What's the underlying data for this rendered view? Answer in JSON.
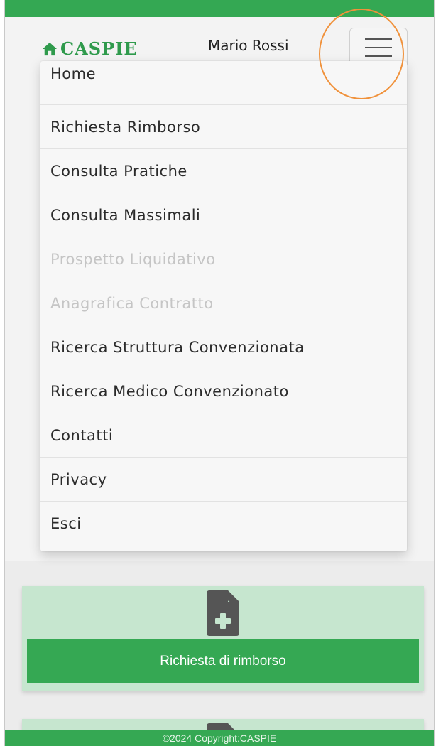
{
  "header": {
    "brand": "CASPIE",
    "brand_icon": "home-icon",
    "user_name": "Mario Rossi",
    "menu_icon": "hamburger-menu-icon",
    "brand_color": "#2f9a4c",
    "accent_color": "#34a853",
    "highlight_color": "#f0913a"
  },
  "menu": {
    "items": [
      {
        "label": "Home",
        "enabled": true
      },
      {
        "label": "Richiesta Rimborso",
        "enabled": true
      },
      {
        "label": "Consulta Pratiche",
        "enabled": true
      },
      {
        "label": "Consulta Massimali",
        "enabled": true
      },
      {
        "label": "Prospetto Liquidativo",
        "enabled": false
      },
      {
        "label": "Anagrafica Contratto",
        "enabled": false
      },
      {
        "label": "Ricerca Struttura Convenzionata",
        "enabled": true
      },
      {
        "label": "Ricerca Medico Convenzionato",
        "enabled": true
      },
      {
        "label": "Contatti",
        "enabled": true
      },
      {
        "label": "Privacy",
        "enabled": true
      },
      {
        "label": "Esci",
        "enabled": true
      }
    ]
  },
  "cards": [
    {
      "icon": "file-add-icon",
      "label": "Richiesta di rimborso"
    },
    {
      "icon": "file-icon"
    }
  ],
  "footer": {
    "text": "©2024 Copyright:CASPIE"
  }
}
